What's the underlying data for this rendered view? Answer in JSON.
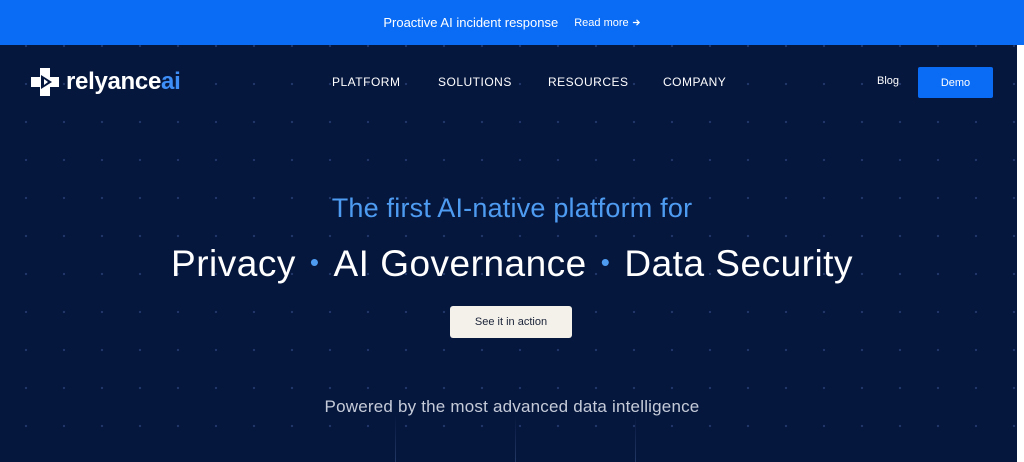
{
  "banner": {
    "message": "Proactive AI incident response",
    "link_label": "Read more",
    "link_icon": "arrow-right-icon"
  },
  "header": {
    "logo": {
      "name": "relyance",
      "suffix": "ai",
      "icon": "relyance-logo-icon"
    },
    "nav": [
      "PLATFORM",
      "SOLUTIONS",
      "RESOURCES",
      "COMPANY"
    ],
    "blog_label": "Blog",
    "demo_label": "Demo"
  },
  "hero": {
    "kicker": "The first AI-native platform for",
    "pillars": [
      "Privacy",
      "AI Governance",
      "Data Security"
    ],
    "separator": "•",
    "cta_label": "See it in action",
    "tagline": "Powered by the most advanced data intelligence"
  },
  "colors": {
    "banner_bg": "#0a6cf5",
    "hero_bg": "#06173e",
    "accent_blue": "#4e9cf2",
    "cta_bg": "#f4f1ea"
  }
}
